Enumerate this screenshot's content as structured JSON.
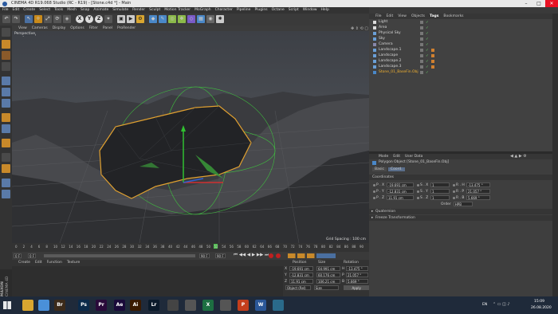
{
  "window": {
    "title": "CINEMA 4D R19.068 Studio (RC - R19) - [Stone.c4d *] - Main"
  },
  "menu": [
    "File",
    "Edit",
    "Create",
    "Select",
    "Tools",
    "Mesh",
    "Snap",
    "Animate",
    "Simulate",
    "Render",
    "Sculpt",
    "Motion Tracker",
    "MoGraph",
    "Character",
    "Pipeline",
    "Plugins",
    "Octane",
    "Script",
    "Window",
    "Help"
  ],
  "layout": {
    "label": "Layout:",
    "value": "Startup"
  },
  "viewport": {
    "menu": [
      "View",
      "Cameras",
      "Display",
      "Options",
      "Filter",
      "Panel",
      "ProRender"
    ],
    "name": "Perspective",
    "grid_spacing": "Grid Spacing : 100 cm"
  },
  "objects": {
    "menu": [
      "File",
      "Edit",
      "View",
      "Objects",
      "Tags",
      "Bookmarks"
    ],
    "items": [
      "Light",
      "Area",
      "Physical Sky",
      "Sky",
      "Camera",
      "Landscape.1",
      "Landscape",
      "Landscape.2",
      "Landscape.3",
      "Stone_01_BaseFin.Obj"
    ],
    "selected": "Stone_01_BaseFin.Obj"
  },
  "timeline": {
    "ticks": [
      "0",
      "2",
      "4",
      "6",
      "8",
      "10",
      "12",
      "14",
      "16",
      "18",
      "20",
      "22",
      "24",
      "26",
      "28",
      "30",
      "32",
      "34",
      "36",
      "38",
      "40",
      "42",
      "44",
      "46",
      "48",
      "50",
      "52",
      "54",
      "56",
      "58",
      "60",
      "62",
      "64",
      "66",
      "68",
      "70",
      "72",
      "74",
      "76",
      "78",
      "80",
      "82",
      "84",
      "86",
      "88",
      "90"
    ],
    "start": "0 F",
    "end": "90 F",
    "current": "90 F",
    "frame": "0 F"
  },
  "materials": {
    "menu": [
      "Create",
      "Edit",
      "Function",
      "Texture"
    ]
  },
  "coords": {
    "headers": [
      "Position",
      "Size",
      "Rotation"
    ],
    "rows": [
      {
        "axis": "X",
        "pos": "-19.691 cm",
        "size": "64.991 cm",
        "rot_label": "H",
        "rot": "-13.475 °"
      },
      {
        "axis": "Y",
        "pos": "-12.831 cm",
        "size": "60.176 cm",
        "rot_label": "P",
        "rot": "21.057 °"
      },
      {
        "axis": "Z",
        "pos": "11.91 cm",
        "size": "106.21 cm",
        "rot_label": "B",
        "rot": "5.669 °"
      }
    ],
    "mode": "Object (Rel)",
    "size_mode": "Size",
    "apply": "Apply"
  },
  "attributes": {
    "menu": [
      "Mode",
      "Edit",
      "User Data"
    ],
    "title": "Polygon Object [Stone_01_BaseFin.Obj]",
    "tabs": [
      "Basic",
      "Coord."
    ],
    "section": "Coordinates",
    "rows": [
      {
        "p_label": "P . X",
        "p": "-19.691 cm",
        "s_label": "S . X",
        "s": "1",
        "r_label": "R . H",
        "r": "-13.475 °"
      },
      {
        "p_label": "P . Y",
        "p": "-12.831 cm",
        "s_label": "S . Y",
        "s": "1",
        "r_label": "R . P",
        "r": "21.057 °"
      },
      {
        "p_label": "P . Z",
        "p": "11.91 cm",
        "s_label": "S . Z",
        "s": "1",
        "r_label": "R . B",
        "r": "5.669 °"
      }
    ],
    "order_label": "Order",
    "order": "HPB",
    "collapsed": [
      "Quaternion",
      "Freeze Transformation"
    ]
  },
  "maxon": {
    "brand": "MAXON",
    "product": "CINEMA 4D"
  },
  "taskbar": {
    "lang": "EN",
    "time": "15:09",
    "date": "26.08.2020",
    "apps": [
      {
        "icon": "folder-icon",
        "label": "",
        "color": "#d9a630"
      },
      {
        "icon": "chrome-icon",
        "label": "",
        "color": "#4a90d9"
      },
      {
        "icon": "bridge-icon",
        "label": "Br",
        "color": "#3b2a1a"
      },
      {
        "icon": "photoshop-icon",
        "label": "Ps",
        "color": "#0b2a4a"
      },
      {
        "icon": "premiere-icon",
        "label": "Pr",
        "color": "#2a0a3a"
      },
      {
        "icon": "aftereffects-icon",
        "label": "Ae",
        "color": "#1a0a3a"
      },
      {
        "icon": "illustrator-icon",
        "label": "Ai",
        "color": "#3a1a00"
      },
      {
        "icon": "lightroom-icon",
        "label": "Lr",
        "color": "#0a1a2a"
      },
      {
        "icon": "cinema4d-icon",
        "label": "",
        "color": "#444"
      },
      {
        "icon": "tool-icon",
        "label": "",
        "color": "#555"
      },
      {
        "icon": "excel-icon",
        "label": "X",
        "color": "#1d6f42"
      },
      {
        "icon": "arrow-icon",
        "label": "",
        "color": "#555"
      },
      {
        "icon": "powerpoint-icon",
        "label": "P",
        "color": "#c43e1c"
      },
      {
        "icon": "word-icon",
        "label": "W",
        "color": "#2b5797"
      },
      {
        "icon": "other-icon",
        "label": "",
        "color": "#2a6a8a"
      }
    ]
  }
}
